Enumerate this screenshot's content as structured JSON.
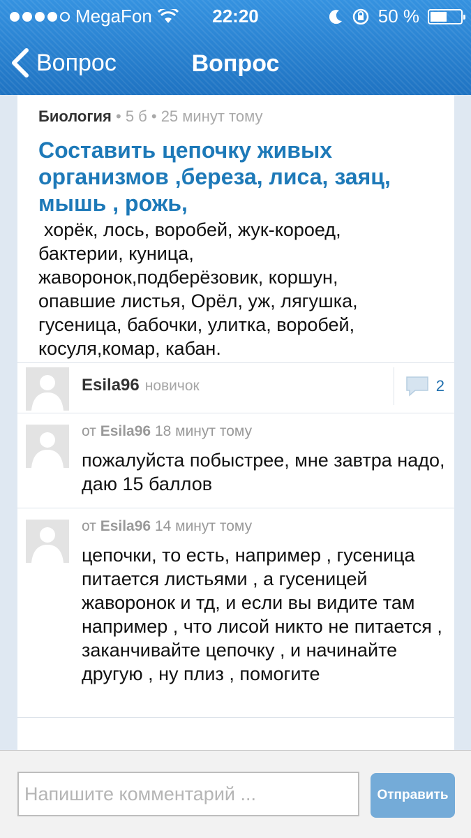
{
  "status_bar": {
    "carrier": "MegaFon",
    "time": "22:20",
    "battery_percent": "50 %"
  },
  "nav": {
    "back_label": "Вопрос",
    "title": "Вопрос"
  },
  "question": {
    "subject": "Биология",
    "meta": " • 5 б • 25 минут тому",
    "title": "Составить цепочку живых организмов ,береза, лиса, заяц, мышь , рожь,",
    "body_lines": [
      "хорёк, лось, воробей, жук-короед,",
      "бактерии, куница,",
      "жаворонок,подберёзовик, коршун,",
      "опавшие листья, Орёл, уж, лягушка,",
      "гусеница, бабочки, улитка, воробей,",
      "косуля,комар, кабан."
    ]
  },
  "author": {
    "name": "Esila96",
    "rank": "новичок",
    "comments_count": "2"
  },
  "comments": [
    {
      "prefix": "от",
      "author": "Esila96",
      "time": "18 минут тому",
      "text": "пожалуйста побыстрее, мне завтра надо, даю 15 баллов"
    },
    {
      "prefix": "от",
      "author": "Esila96",
      "time": "14 минут тому",
      "text": "цепочки, то есть, например , гусеница питается листьями , а гусеницей жаворонок и тд, и если вы видите там например , что лисой никто не питается , заканчивайте цепочку , и начинайте другую , ну плиз , помогите"
    }
  ],
  "composer": {
    "placeholder": "Напишите комментарий ...",
    "send_label": "Отправить"
  },
  "colors": {
    "nav_blue": "#2a80cf",
    "title_blue": "#1d79b8",
    "send_button": "#74abd8"
  }
}
